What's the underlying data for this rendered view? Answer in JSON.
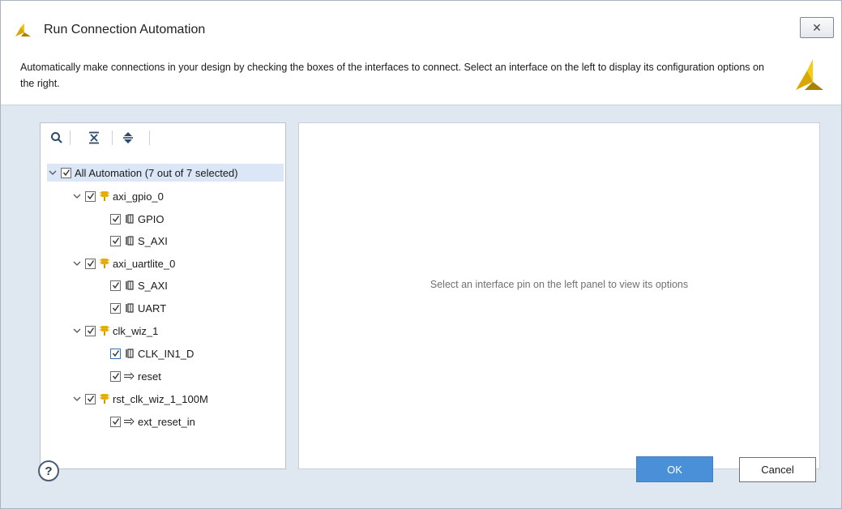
{
  "window": {
    "title": "Run Connection Automation",
    "close_glyph": "✕"
  },
  "description": "Automatically make connections in your design by checking the boxes of the interfaces to connect. Select an interface on the left to display its configuration options on the right.",
  "tree": {
    "toolbar": {
      "search_icon": "search-icon",
      "collapse_all_icon": "collapse-all-icon",
      "expand_all_icon": "expand-all-icon"
    },
    "root": {
      "label": "All Automation (7 out of 7 selected)",
      "checked": true,
      "expanded": true
    },
    "nodes": [
      {
        "label": "axi_gpio_0",
        "type": "ip",
        "checked": true,
        "expanded": true,
        "children": [
          {
            "label": "GPIO",
            "type": "bus-interface",
            "checked": true
          },
          {
            "label": "S_AXI",
            "type": "bus-interface",
            "checked": true
          }
        ]
      },
      {
        "label": "axi_uartlite_0",
        "type": "ip",
        "checked": true,
        "expanded": true,
        "children": [
          {
            "label": "S_AXI",
            "type": "bus-interface",
            "checked": true
          },
          {
            "label": "UART",
            "type": "bus-interface",
            "checked": true
          }
        ]
      },
      {
        "label": "clk_wiz_1",
        "type": "ip",
        "checked": true,
        "expanded": true,
        "children": [
          {
            "label": "CLK_IN1_D",
            "type": "bus-interface",
            "checked": true
          },
          {
            "label": "reset",
            "type": "port",
            "checked": true
          }
        ]
      },
      {
        "label": "rst_clk_wiz_1_100M",
        "type": "ip",
        "checked": true,
        "expanded": true,
        "children": [
          {
            "label": "ext_reset_in",
            "type": "port",
            "checked": true
          }
        ]
      }
    ]
  },
  "options_panel": {
    "hint": "Select an interface pin on the left panel to view its options"
  },
  "footer": {
    "help_label": "?",
    "ok_label": "OK",
    "cancel_label": "Cancel"
  },
  "colors": {
    "accent": "#4a90d9",
    "dialog_bg": "#dfe7f1",
    "ip_icon": "#f2b705",
    "logo": "#c9a400"
  }
}
